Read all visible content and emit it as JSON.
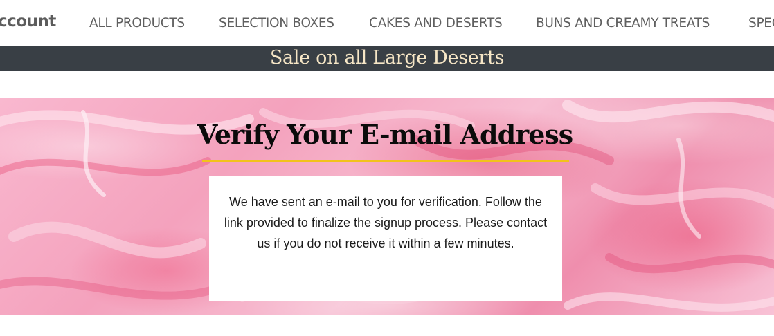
{
  "nav": {
    "account_label": "ccount",
    "links": [
      {
        "label": "ALL PRODUCTS"
      },
      {
        "label": "SELECTION BOXES"
      },
      {
        "label": "CAKES AND DESERTS"
      },
      {
        "label": "BUNS AND CREAMY TREATS"
      },
      {
        "label": "SPEC"
      }
    ]
  },
  "banner": {
    "text": "Sale on all Large Deserts"
  },
  "hero": {
    "title": "Verify Your E-mail Address",
    "message": "We have sent an e-mail to you for verification. Follow the link provided to finalize the signup process. Please contact us if you do not receive it within a few minutes."
  },
  "colors": {
    "banner_bg": "#393f45",
    "banner_text": "#f6e6c6",
    "underline": "#f2c21b",
    "nav_text": "#5f5f5f"
  }
}
